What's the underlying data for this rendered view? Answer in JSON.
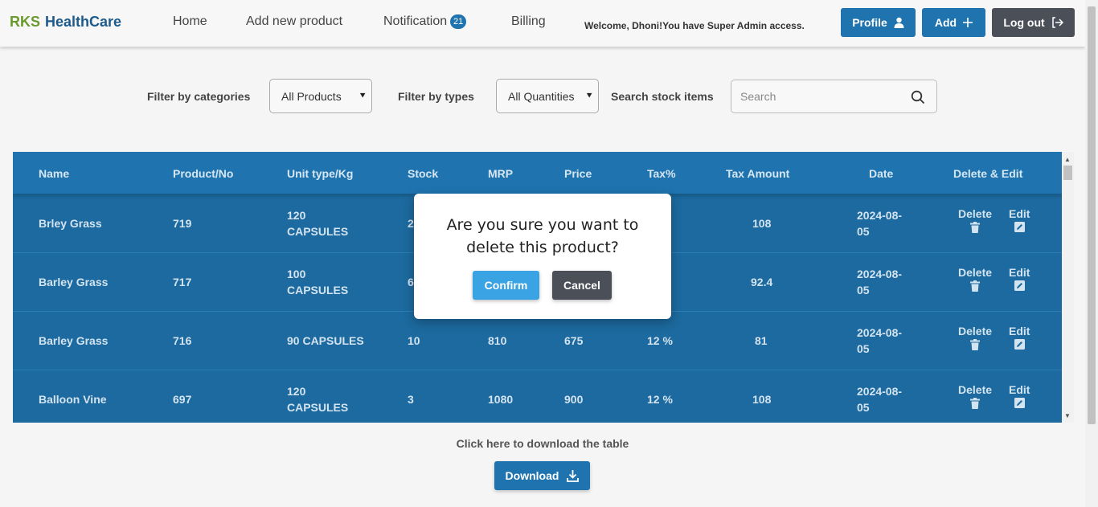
{
  "brand": {
    "part1": "RKS",
    "part2": "HealthCare"
  },
  "nav": {
    "home": "Home",
    "add_product": "Add new product",
    "notification": "Notification",
    "notification_count": "21",
    "billing": "Billing",
    "welcome": "Welcome, Dhoni!You have Super Admin access.",
    "profile": "Profile",
    "add": "Add",
    "logout": "Log out"
  },
  "filters": {
    "categories_label": "Filter by categories",
    "categories_value": "All Products",
    "types_label": "Filter by types",
    "types_value": "All Quantities",
    "search_label": "Search stock items",
    "search_placeholder": "Search"
  },
  "table": {
    "headers": [
      "Name",
      "Product/No",
      "Unit type/Kg",
      "Stock",
      "MRP",
      "Price",
      "Tax%",
      "Tax Amount",
      "Date",
      "Delete & Edit"
    ],
    "rows": [
      {
        "name": "Brley Grass",
        "no": "719",
        "unit1": "120",
        "unit2": "CAPSULES",
        "stock": "2",
        "mrp": "",
        "price": "",
        "tax": "",
        "tax_amount": "108",
        "date1": "2024-08-",
        "date2": "05"
      },
      {
        "name": "Barley Grass",
        "no": "717",
        "unit1": "100",
        "unit2": "CAPSULES",
        "stock": "6",
        "mrp": "",
        "price": "",
        "tax": "",
        "tax_amount": "92.4",
        "date1": "2024-08-",
        "date2": "05"
      },
      {
        "name": "Barley Grass",
        "no": "716",
        "unit1": "90 CAPSULES",
        "unit2": "",
        "stock": "10",
        "mrp": "810",
        "price": "675",
        "tax": "12 %",
        "tax_amount": "81",
        "date1": "2024-08-",
        "date2": "05"
      },
      {
        "name": "Balloon Vine",
        "no": "697",
        "unit1": "120",
        "unit2": "CAPSULES",
        "stock": "3",
        "mrp": "1080",
        "price": "900",
        "tax": "12 %",
        "tax_amount": "108",
        "date1": "2024-08-",
        "date2": "05"
      }
    ],
    "delete_label": "Delete",
    "edit_label": "Edit"
  },
  "footer": {
    "download_label": "Click here to download the table",
    "download_button": "Download"
  },
  "modal": {
    "message": "Are you sure you want to delete this product?",
    "confirm": "Confirm",
    "cancel": "Cancel"
  },
  "colors": {
    "primary": "#1f74b0",
    "table_bg": "#1c6a9f",
    "dark_button": "#4a4f58",
    "confirm": "#3aa3e3",
    "brand_green": "#6a9a2e",
    "brand_blue": "#1c5b8c"
  }
}
